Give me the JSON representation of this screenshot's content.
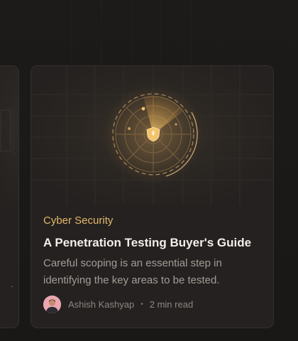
{
  "article": {
    "category": "Cyber Security",
    "title": "A Penetration Testing Buyer's Guide",
    "excerpt": "Careful scoping is an essential step in identifying the key areas to be tested.",
    "author": "Ashish Kashyap",
    "separator": "•",
    "read_time": "2 min read",
    "illustration_icon": "radar-shield-icon",
    "accent_color": "#e5b96a"
  },
  "previous_card": {
    "trailing_text": "."
  }
}
